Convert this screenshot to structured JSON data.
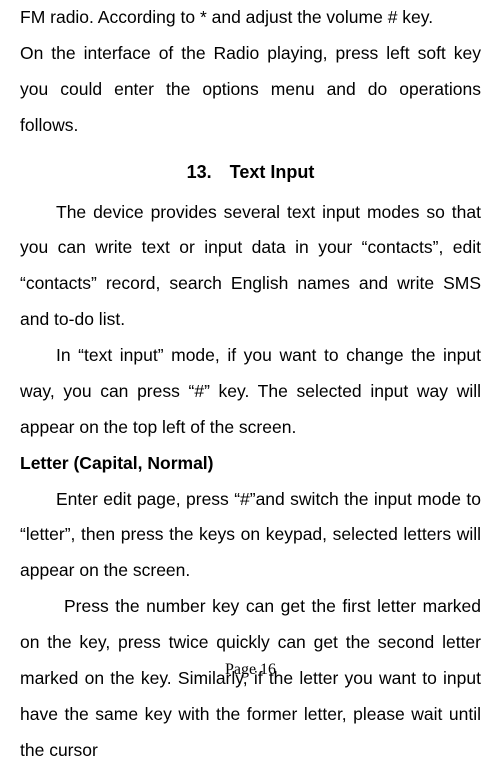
{
  "body": {
    "p1": "FM radio. According to * and adjust the volume # key.",
    "p2": "On the interface of the Radio playing, press left soft key you could enter the options menu and do operations follows.",
    "heading": "13. Text Input",
    "p3": "The device provides several text input modes so that you can write text or input data in your “contacts”, edit “contacts” record, search English names and write SMS and to-do list.",
    "p4": "In “text input” mode, if you want to change the input way, you can press “#” key. The selected input way will appear on the top left of the screen.",
    "subheading": "Letter (Capital, Normal)",
    "p5": "Enter edit page, press “#”and switch the input mode to “letter”, then press the keys on keypad, selected letters will appear on the screen.",
    "p6": "Press the number key can get the first letter marked on the key, press twice quickly can get the second letter marked on the key. Similarly, if the letter you want to input have the same key with the former letter, please wait until the cursor"
  },
  "footer": {
    "page_label": "Page 16"
  }
}
